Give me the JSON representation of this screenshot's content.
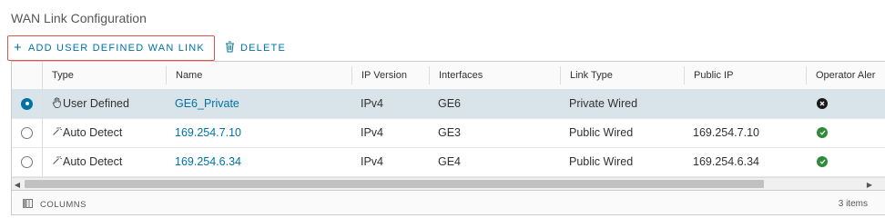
{
  "page": {
    "title": "WAN Link Configuration"
  },
  "toolbar": {
    "add_label": "ADD USER DEFINED WAN LINK",
    "delete_label": "DELETE"
  },
  "grid": {
    "columns": [
      "Type",
      "Name",
      "IP Version",
      "Interfaces",
      "Link Type",
      "Public IP",
      "Operator Aler"
    ],
    "rows": [
      {
        "selected": true,
        "type": "User Defined",
        "type_icon": "hand-icon",
        "name": "GE6_Private",
        "ip_version": "IPv4",
        "interface": "GE6",
        "link_type": "Private Wired",
        "public_ip": "",
        "alert": "error"
      },
      {
        "selected": false,
        "type": "Auto Detect",
        "type_icon": "wand-icon",
        "name": "169.254.7.10",
        "ip_version": "IPv4",
        "interface": "GE3",
        "link_type": "Public Wired",
        "public_ip": "169.254.7.10",
        "alert": "ok"
      },
      {
        "selected": false,
        "type": "Auto Detect",
        "type_icon": "wand-icon",
        "name": "169.254.6.34",
        "ip_version": "IPv4",
        "interface": "GE4",
        "link_type": "Public Wired",
        "public_ip": "169.254.6.34",
        "alert": "ok"
      }
    ],
    "footer": {
      "columns_label": "COLUMNS",
      "count": "3 items"
    }
  },
  "colors": {
    "accent": "#0072a3",
    "selected_row": "#d9e4ea",
    "ok": "#2e8b3a",
    "error": "#1a1a1a",
    "highlight_border": "#d9534f"
  }
}
